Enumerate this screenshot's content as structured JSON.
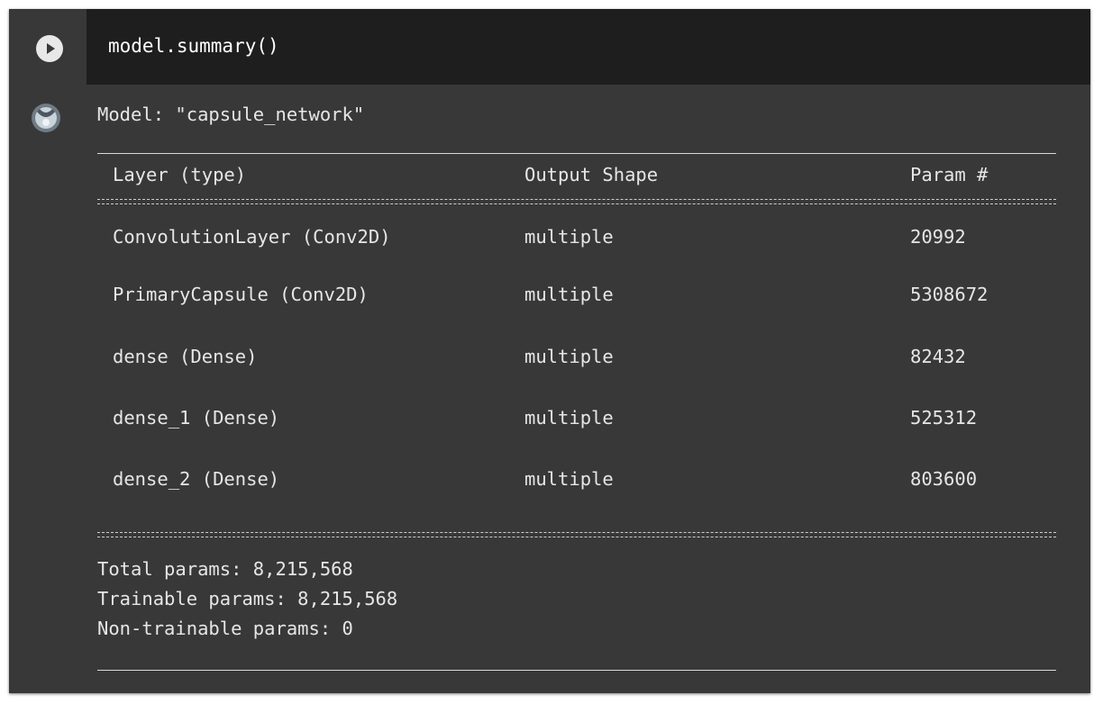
{
  "cell": {
    "code": "model.summary()",
    "output_title": "Model: \"capsule_network\""
  },
  "table": {
    "headers": [
      "Layer (type)",
      "Output Shape",
      "Param #"
    ],
    "rows": [
      [
        "ConvolutionLayer (Conv2D)",
        "multiple",
        "20992"
      ],
      [
        "PrimaryCapsule (Conv2D)",
        "multiple",
        "5308672"
      ],
      [
        "dense (Dense)",
        "multiple",
        "82432"
      ],
      [
        "dense_1 (Dense)",
        "multiple",
        "525312"
      ],
      [
        "dense_2 (Dense)",
        "multiple",
        "803600"
      ]
    ]
  },
  "totals": {
    "total": "Total params: 8,215,568",
    "trainable": "Trainable params: 8,215,568",
    "non_trainable": "Non-trainable params: 0"
  },
  "icons": {
    "run": "play-icon",
    "output": "output-avatar-icon"
  },
  "colors": {
    "cell_background": "#383838",
    "code_background": "#1e1e1e",
    "text": "#e6e6e6"
  }
}
